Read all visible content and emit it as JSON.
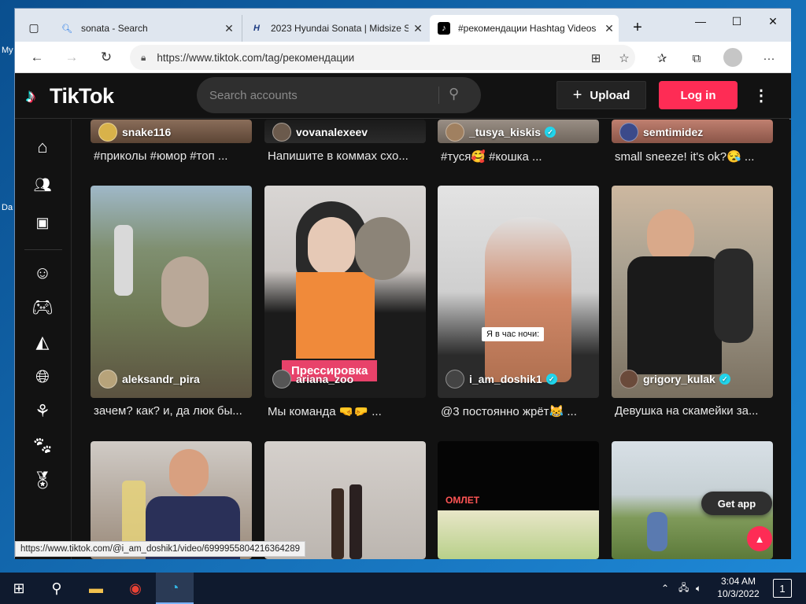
{
  "desktop": {
    "icon1_label": "My",
    "icon2_label": "Da"
  },
  "browser": {
    "tabs": [
      {
        "title": "sonata - Search",
        "favicon": "search-icon"
      },
      {
        "title": "2023 Hyundai Sonata | Midsize S",
        "favicon": "hyundai-logo-icon"
      },
      {
        "title": "#рекомендации Hashtag Videos",
        "favicon": "tiktok-logo-icon"
      }
    ],
    "new_tab": "+",
    "url": "https://www.tiktok.com/tag/рекомендации",
    "status_url": "https://www.tiktok.com/@i_am_doshik1/video/6999955804216364289"
  },
  "tiktok": {
    "logo_text": "TikTok",
    "search_placeholder": "Search accounts",
    "upload_label": "Upload",
    "login_label": "Log in",
    "get_app_label": "Get app",
    "sidebar_icons": [
      "home-icon",
      "following-icon",
      "live-icon",
      "comedy-icon",
      "gaming-icon",
      "food-icon",
      "travel-icon",
      "beauty-icon",
      "animals-icon",
      "sports-icon"
    ]
  },
  "videos_top": [
    {
      "author": "snake116",
      "verified": false,
      "desc": "#приколы #юмор #топ ..."
    },
    {
      "author": "vovanalexeev",
      "verified": false,
      "desc": "Напишите в коммах схо..."
    },
    {
      "author": "_tusya_kiskis",
      "verified": true,
      "desc": "#туся🥰 #кошка ..."
    },
    {
      "author": "semtimidez",
      "verified": false,
      "desc": "small sneeze! it's ok?😪 ..."
    }
  ],
  "videos_mid": [
    {
      "author": "aleksandr_pira",
      "verified": false,
      "desc": "зачем? как? и, да люк бы...",
      "overlay": ""
    },
    {
      "author": "ariana_zoo",
      "verified": false,
      "desc": "Мы команда 🤜🤛 ...",
      "overlay": "Прессировка"
    },
    {
      "author": "i_am_doshik1",
      "verified": true,
      "desc": "@3 постоянно жрёт😹 ...",
      "overlay": "Я в час ночи:"
    },
    {
      "author": "grigory_kulak",
      "verified": true,
      "desc": "Девушка на скамейки за...",
      "overlay": ""
    }
  ],
  "videos_bottom": [
    {
      "overlay": ""
    },
    {
      "overlay": ""
    },
    {
      "overlay": "ОМЛЕТ"
    },
    {
      "overlay": ""
    }
  ],
  "taskbar": {
    "time": "3:04 AM",
    "date": "10/3/2022",
    "notification_count": "1"
  }
}
